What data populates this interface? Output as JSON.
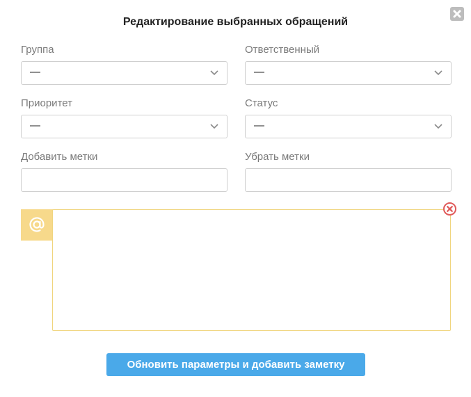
{
  "dialog": {
    "title": "Редактирование выбранных обращений",
    "close_icon": "close-x-icon"
  },
  "fields": {
    "group": {
      "label": "Группа",
      "value": "—"
    },
    "assignee": {
      "label": "Ответственный",
      "value": "—"
    },
    "priority": {
      "label": "Приоритет",
      "value": "—"
    },
    "status": {
      "label": "Статус",
      "value": "—"
    },
    "add_tags": {
      "label": "Добавить метки",
      "value": ""
    },
    "remove_tags": {
      "label": "Убрать метки",
      "value": ""
    }
  },
  "note": {
    "tab_icon": "at-sign-icon",
    "remove_icon": "remove-circle-icon",
    "value": ""
  },
  "submit": {
    "label": "Обновить параметры и добавить заметку"
  },
  "colors": {
    "accent_button": "#4aa9e9",
    "note_tab": "#f7d98b",
    "note_border": "#f0d57e",
    "remove_icon": "#e05a5a",
    "close_button": "#bdbdbd"
  }
}
